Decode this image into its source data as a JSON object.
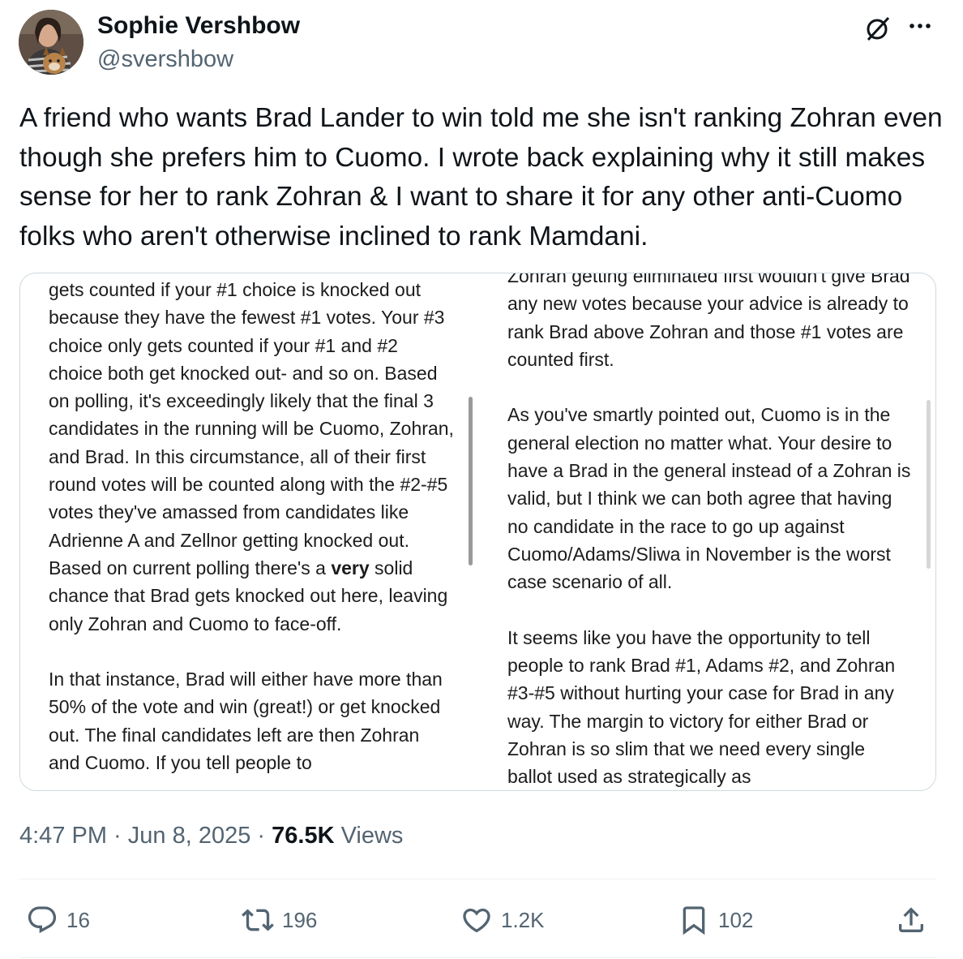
{
  "author": {
    "name": "Sophie Vershbow",
    "handle": "@svershbow"
  },
  "tweet_text": "A friend who wants Brad Lander to win told me she isn't ranking Zohran even though she prefers him to Cuomo. I wrote back explaining why it still makes sense for her to rank Zohran & I want to share it for any other anti-Cuomo folks who aren't otherwise inclined to rank Mamdani.",
  "media": {
    "left_column": {
      "p1_a": "gets counted if your #1 choice is knocked out because they have the fewest #1 votes. Your #3 choice only gets counted if your #1 and #2 choice both get knocked out- and so on. Based on polling, it's exceedingly likely that the final 3 candidates in the running will be Cuomo, Zohran, and Brad. In this circumstance, all of their first round votes will be counted along with the #2-#5 votes they've amassed from candidates like Adrienne A and Zellnor getting knocked out. Based on current polling there's a ",
      "p1_bold": "very",
      "p1_b": " solid chance that Brad gets knocked out here, leaving only Zohran and Cuomo to face-off.",
      "p2": "In that instance, Brad will either have more than 50% of the vote and win (great!) or get knocked out. The final candidates left are then Zohran and Cuomo. If you tell people to"
    },
    "right_column": {
      "p1": "Zohran getting eliminated first wouldn't give Brad any new votes because your advice is already to rank Brad above Zohran and those #1 votes are counted first.",
      "p2": "As you've smartly pointed out, Cuomo is in the general election no matter what. Your desire to have a Brad in the general instead of a Zohran is valid, but I think we can both agree that having no candidate in the race to go up against Cuomo/Adams/Sliwa in November is the worst case scenario of all.",
      "p3": "It seems like you have the opportunity to tell people to rank Brad #1, Adams #2, and Zohran #3-#5 without hurting your case for Brad in any way. The margin to victory for either Brad or Zohran is so slim that we need every single ballot used as strategically as"
    }
  },
  "meta": {
    "time": "4:47 PM",
    "sep1": " · ",
    "date": "Jun 8, 2025",
    "sep2": " · ",
    "views_count": "76.5K",
    "views_label": " Views"
  },
  "actions": {
    "replies": "16",
    "reposts": "196",
    "likes": "1.2K",
    "bookmarks": "102"
  },
  "icons": {
    "grok": "grok-icon",
    "more": "more-icon",
    "reply": "reply-icon",
    "repost": "repost-icon",
    "like": "heart-icon",
    "bookmark": "bookmark-icon",
    "share": "share-icon"
  },
  "colors": {
    "text": "#0f1419",
    "secondary": "#536471",
    "border": "#cfd9de",
    "divider": "#eff3f4"
  }
}
